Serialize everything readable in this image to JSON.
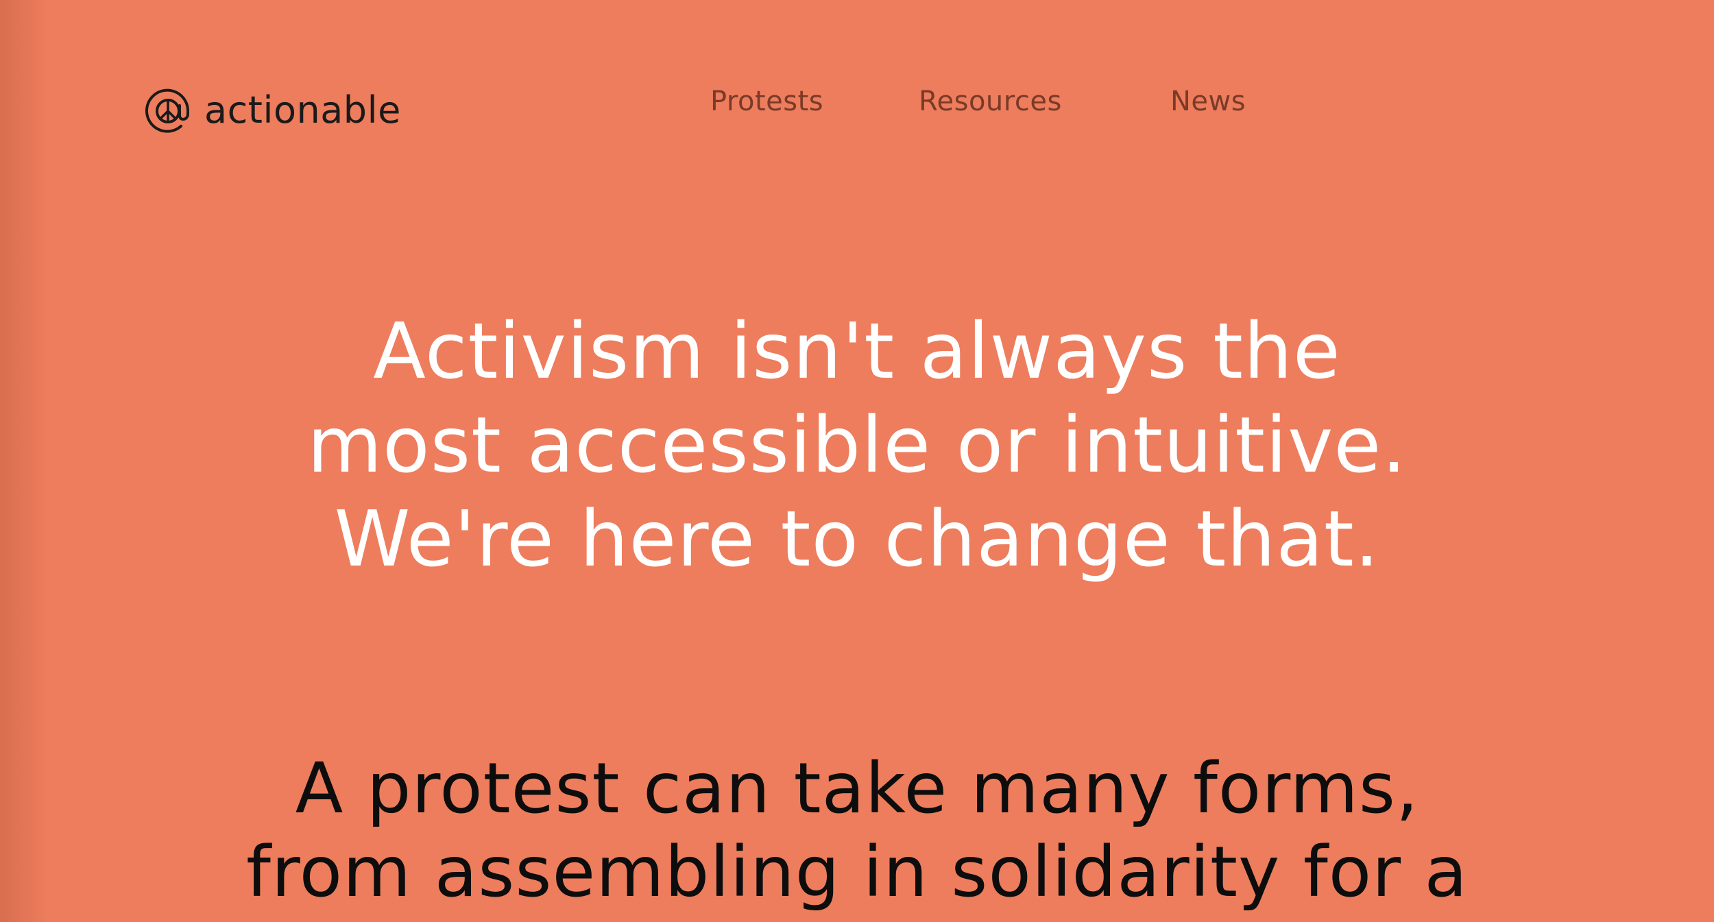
{
  "colors": {
    "background": "#ED7D5C",
    "hero_text": "#FFFFFF",
    "nav_text": "#7A3A28",
    "body_text": "#0D0D0D",
    "logo_text": "#1A1A1A"
  },
  "header": {
    "logo": {
      "icon": "at-peace-sign-icon",
      "text": "actionable"
    },
    "nav": [
      {
        "label": "Protests"
      },
      {
        "label": "Resources"
      },
      {
        "label": "News"
      }
    ]
  },
  "hero": {
    "lines": [
      "Activism isn't always the",
      "most accessible or intuitive.",
      "We're here to change that."
    ]
  },
  "intro": {
    "lines": [
      "A protest can take many forms,",
      "from assembling in solidarity for a"
    ]
  }
}
